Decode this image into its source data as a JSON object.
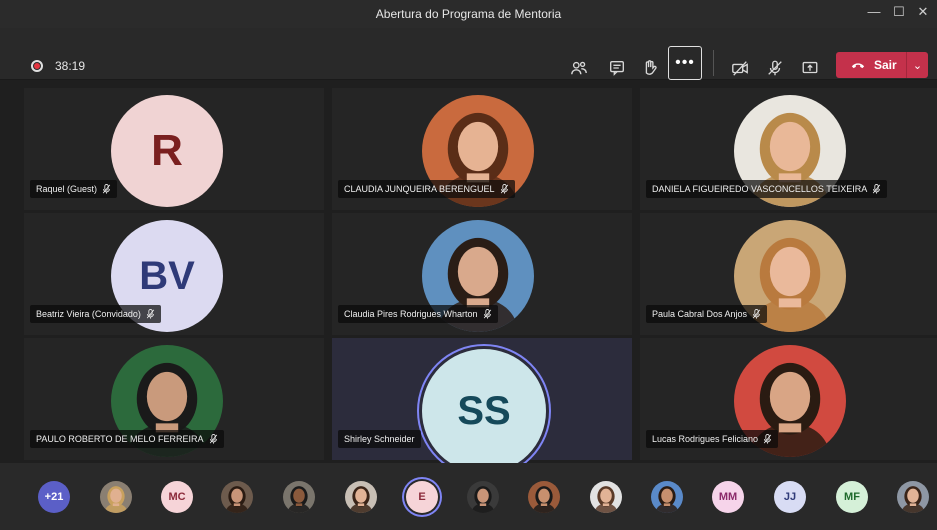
{
  "window": {
    "title": "Abertura do Programa de Mentoria",
    "controls": [
      "—",
      "☐",
      "✕"
    ]
  },
  "toolbar": {
    "timer": "38:19",
    "more_label": "•••",
    "leave_label": "Sair",
    "leave_chevron": "⌄"
  },
  "participants": [
    {
      "name": "Raquel (Guest)",
      "initials": "R",
      "type": "initials",
      "bg": "#f0d3d3",
      "fg": "#7a1f1f"
    },
    {
      "name": "CLAUDIA JUNQUEIRA BERENGUEL",
      "type": "photo",
      "bg": "#c96a3e",
      "skin": "#e6b393",
      "hair": "#5a2d17"
    },
    {
      "name": "DANIELA FIGUEIREDO VASCONCELLOS TEIXEIRA",
      "type": "photo",
      "bg": "#e9e6df",
      "skin": "#e9b898",
      "hair": "#b98a4a"
    },
    {
      "name": "Beatriz Vieira (Convidado)",
      "initials": "BV",
      "type": "initials",
      "bg": "#dcdaf1",
      "fg": "#2f3a78"
    },
    {
      "name": "Claudia Pires Rodrigues Wharton",
      "type": "photo",
      "bg": "#5f90bf",
      "skin": "#d9a98c",
      "hair": "#2a1d16"
    },
    {
      "name": "Paula Cabral Dos Anjos",
      "type": "photo",
      "bg": "#c9a676",
      "skin": "#eab99b",
      "hair": "#b97a3e"
    },
    {
      "name": "PAULO ROBERTO DE MELO FERREIRA",
      "type": "photo",
      "bg": "#2c6a3c",
      "skin": "#c99a7c",
      "hair": "#1a1a1a"
    },
    {
      "name": "Shirley Schneider",
      "initials": "SS",
      "type": "initials",
      "bg": "#cde6ea",
      "fg": "#15495a"
    },
    {
      "name": "Lucas Rodrigues Feliciano",
      "type": "photo",
      "bg": "#d14a40",
      "skin": "#d9a585",
      "hair": "#2a1b12"
    }
  ],
  "strip": [
    {
      "label": "+21",
      "type": "initials",
      "bg": "#5b5fc7",
      "fg": "#ffffff"
    },
    {
      "type": "photo",
      "bg": "#8a7f72",
      "skin": "#e0b090",
      "hair": "#c9a15e"
    },
    {
      "label": "MC",
      "type": "initials",
      "bg": "#f6d4d8",
      "fg": "#8b2a3a"
    },
    {
      "type": "photo",
      "bg": "#6d5b4d",
      "skin": "#c99578",
      "hair": "#2a1b12"
    },
    {
      "type": "photo",
      "bg": "#7a756c",
      "skin": "#8b5a3c",
      "hair": "#1a1a1a"
    },
    {
      "type": "photo",
      "bg": "#c8bfb5",
      "skin": "#e2b396",
      "hair": "#3a2418"
    },
    {
      "label": "E",
      "type": "initials",
      "bg": "#f6d4d8",
      "fg": "#8b2a3a",
      "selected": true
    },
    {
      "type": "photo",
      "bg": "#3a3a3a",
      "skin": "#c99578",
      "hair": "#1a1a1a"
    },
    {
      "type": "photo",
      "bg": "#9a5a3a",
      "skin": "#c7906e",
      "hair": "#1a1a1a"
    },
    {
      "type": "photo",
      "bg": "#e2e2e2",
      "skin": "#e2b396",
      "hair": "#5a3a28"
    },
    {
      "type": "photo",
      "bg": "#5a8ac9",
      "skin": "#c7906e",
      "hair": "#2a1b12"
    },
    {
      "label": "MM",
      "type": "initials",
      "bg": "#f6d4ea",
      "fg": "#8b2a6a"
    },
    {
      "label": "JJ",
      "type": "initials",
      "bg": "#d8dcf4",
      "fg": "#2f3a78"
    },
    {
      "label": "MF",
      "type": "initials",
      "bg": "#d5f0d8",
      "fg": "#1f6a2c"
    },
    {
      "type": "photo",
      "bg": "#8e97a4",
      "skin": "#e2b396",
      "hair": "#3a2418"
    }
  ]
}
